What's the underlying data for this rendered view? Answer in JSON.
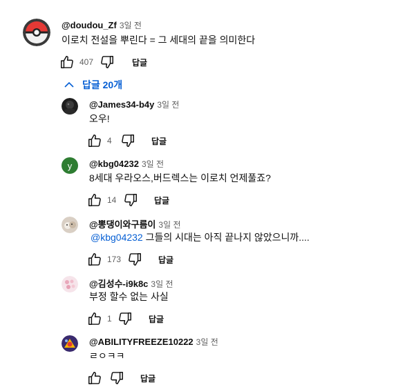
{
  "top_comment": {
    "author": "@doudou_Zf",
    "time": "3일 전",
    "text": "이로치  전설을 뿌린다 = 그 세대의 끝을 의미한다",
    "likes": "407",
    "reply_label": "답글"
  },
  "replies_toggle": {
    "label": "답글 20개",
    "icon": "chevron-up-icon"
  },
  "replies": [
    {
      "author": "@James34-b4y",
      "time": "3일 전",
      "mention": "",
      "text": "오우!",
      "likes": "4",
      "reply_label": "답글",
      "avatar_letter": ""
    },
    {
      "author": "@kbg04232",
      "time": "3일 전",
      "mention": "",
      "text": "8세대 우라오스,버드렉스는 이로치 언제풀죠?",
      "likes": "14",
      "reply_label": "답글",
      "avatar_letter": "y"
    },
    {
      "author": "@뽕댕이와구름이",
      "time": "3일 전",
      "mention": "@kbg04232",
      "text": "그들의 시대는 아직 끝나지 않았으니까....",
      "likes": "173",
      "reply_label": "답글",
      "avatar_letter": ""
    },
    {
      "author": "@김성수-i9k8c",
      "time": "3일 전",
      "mention": "",
      "text": "부정 할수 없는 사실",
      "likes": "1",
      "reply_label": "답글",
      "avatar_letter": ""
    },
    {
      "author": "@ABILITYFREEZE10222",
      "time": "3일 전",
      "mention": "",
      "text": "ㄹㅇㅋㅋ",
      "likes": "",
      "reply_label": "답글",
      "avatar_letter": ""
    }
  ],
  "colors": {
    "link": "#065fd4",
    "secondary_text": "#606060",
    "avatar_green": "#2e7d32"
  }
}
